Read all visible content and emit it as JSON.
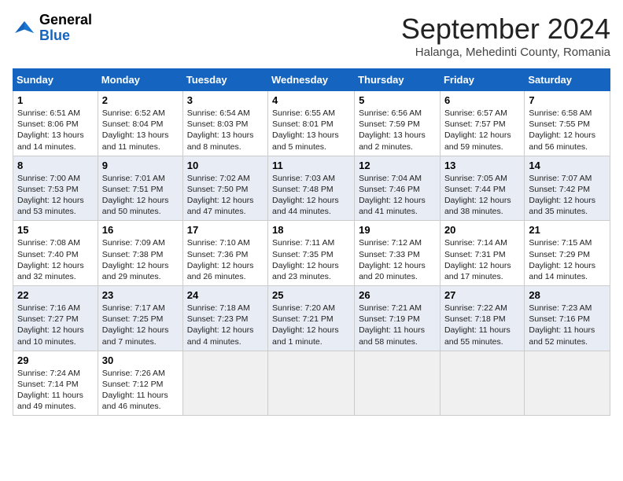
{
  "header": {
    "logo": {
      "general": "General",
      "blue": "Blue"
    },
    "title": "September 2024",
    "location": "Halanga, Mehedinti County, Romania"
  },
  "weekdays": [
    "Sunday",
    "Monday",
    "Tuesday",
    "Wednesday",
    "Thursday",
    "Friday",
    "Saturday"
  ],
  "weeks": [
    [
      {
        "day": "1",
        "sunrise": "Sunrise: 6:51 AM",
        "sunset": "Sunset: 8:06 PM",
        "daylight": "Daylight: 13 hours and 14 minutes."
      },
      {
        "day": "2",
        "sunrise": "Sunrise: 6:52 AM",
        "sunset": "Sunset: 8:04 PM",
        "daylight": "Daylight: 13 hours and 11 minutes."
      },
      {
        "day": "3",
        "sunrise": "Sunrise: 6:54 AM",
        "sunset": "Sunset: 8:03 PM",
        "daylight": "Daylight: 13 hours and 8 minutes."
      },
      {
        "day": "4",
        "sunrise": "Sunrise: 6:55 AM",
        "sunset": "Sunset: 8:01 PM",
        "daylight": "Daylight: 13 hours and 5 minutes."
      },
      {
        "day": "5",
        "sunrise": "Sunrise: 6:56 AM",
        "sunset": "Sunset: 7:59 PM",
        "daylight": "Daylight: 13 hours and 2 minutes."
      },
      {
        "day": "6",
        "sunrise": "Sunrise: 6:57 AM",
        "sunset": "Sunset: 7:57 PM",
        "daylight": "Daylight: 12 hours and 59 minutes."
      },
      {
        "day": "7",
        "sunrise": "Sunrise: 6:58 AM",
        "sunset": "Sunset: 7:55 PM",
        "daylight": "Daylight: 12 hours and 56 minutes."
      }
    ],
    [
      {
        "day": "8",
        "sunrise": "Sunrise: 7:00 AM",
        "sunset": "Sunset: 7:53 PM",
        "daylight": "Daylight: 12 hours and 53 minutes."
      },
      {
        "day": "9",
        "sunrise": "Sunrise: 7:01 AM",
        "sunset": "Sunset: 7:51 PM",
        "daylight": "Daylight: 12 hours and 50 minutes."
      },
      {
        "day": "10",
        "sunrise": "Sunrise: 7:02 AM",
        "sunset": "Sunset: 7:50 PM",
        "daylight": "Daylight: 12 hours and 47 minutes."
      },
      {
        "day": "11",
        "sunrise": "Sunrise: 7:03 AM",
        "sunset": "Sunset: 7:48 PM",
        "daylight": "Daylight: 12 hours and 44 minutes."
      },
      {
        "day": "12",
        "sunrise": "Sunrise: 7:04 AM",
        "sunset": "Sunset: 7:46 PM",
        "daylight": "Daylight: 12 hours and 41 minutes."
      },
      {
        "day": "13",
        "sunrise": "Sunrise: 7:05 AM",
        "sunset": "Sunset: 7:44 PM",
        "daylight": "Daylight: 12 hours and 38 minutes."
      },
      {
        "day": "14",
        "sunrise": "Sunrise: 7:07 AM",
        "sunset": "Sunset: 7:42 PM",
        "daylight": "Daylight: 12 hours and 35 minutes."
      }
    ],
    [
      {
        "day": "15",
        "sunrise": "Sunrise: 7:08 AM",
        "sunset": "Sunset: 7:40 PM",
        "daylight": "Daylight: 12 hours and 32 minutes."
      },
      {
        "day": "16",
        "sunrise": "Sunrise: 7:09 AM",
        "sunset": "Sunset: 7:38 PM",
        "daylight": "Daylight: 12 hours and 29 minutes."
      },
      {
        "day": "17",
        "sunrise": "Sunrise: 7:10 AM",
        "sunset": "Sunset: 7:36 PM",
        "daylight": "Daylight: 12 hours and 26 minutes."
      },
      {
        "day": "18",
        "sunrise": "Sunrise: 7:11 AM",
        "sunset": "Sunset: 7:35 PM",
        "daylight": "Daylight: 12 hours and 23 minutes."
      },
      {
        "day": "19",
        "sunrise": "Sunrise: 7:12 AM",
        "sunset": "Sunset: 7:33 PM",
        "daylight": "Daylight: 12 hours and 20 minutes."
      },
      {
        "day": "20",
        "sunrise": "Sunrise: 7:14 AM",
        "sunset": "Sunset: 7:31 PM",
        "daylight": "Daylight: 12 hours and 17 minutes."
      },
      {
        "day": "21",
        "sunrise": "Sunrise: 7:15 AM",
        "sunset": "Sunset: 7:29 PM",
        "daylight": "Daylight: 12 hours and 14 minutes."
      }
    ],
    [
      {
        "day": "22",
        "sunrise": "Sunrise: 7:16 AM",
        "sunset": "Sunset: 7:27 PM",
        "daylight": "Daylight: 12 hours and 10 minutes."
      },
      {
        "day": "23",
        "sunrise": "Sunrise: 7:17 AM",
        "sunset": "Sunset: 7:25 PM",
        "daylight": "Daylight: 12 hours and 7 minutes."
      },
      {
        "day": "24",
        "sunrise": "Sunrise: 7:18 AM",
        "sunset": "Sunset: 7:23 PM",
        "daylight": "Daylight: 12 hours and 4 minutes."
      },
      {
        "day": "25",
        "sunrise": "Sunrise: 7:20 AM",
        "sunset": "Sunset: 7:21 PM",
        "daylight": "Daylight: 12 hours and 1 minute."
      },
      {
        "day": "26",
        "sunrise": "Sunrise: 7:21 AM",
        "sunset": "Sunset: 7:19 PM",
        "daylight": "Daylight: 11 hours and 58 minutes."
      },
      {
        "day": "27",
        "sunrise": "Sunrise: 7:22 AM",
        "sunset": "Sunset: 7:18 PM",
        "daylight": "Daylight: 11 hours and 55 minutes."
      },
      {
        "day": "28",
        "sunrise": "Sunrise: 7:23 AM",
        "sunset": "Sunset: 7:16 PM",
        "daylight": "Daylight: 11 hours and 52 minutes."
      }
    ],
    [
      {
        "day": "29",
        "sunrise": "Sunrise: 7:24 AM",
        "sunset": "Sunset: 7:14 PM",
        "daylight": "Daylight: 11 hours and 49 minutes."
      },
      {
        "day": "30",
        "sunrise": "Sunrise: 7:26 AM",
        "sunset": "Sunset: 7:12 PM",
        "daylight": "Daylight: 11 hours and 46 minutes."
      },
      null,
      null,
      null,
      null,
      null
    ]
  ]
}
